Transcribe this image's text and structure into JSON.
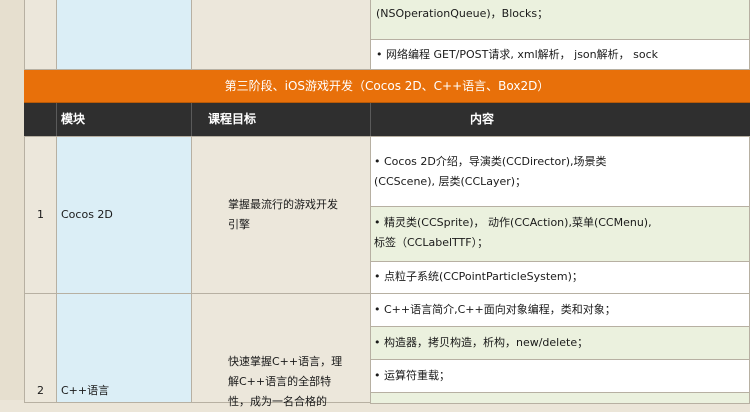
{
  "top_rows": {
    "row_a": "(NSOperationQueue)，Blocks；",
    "row_b": "•  网络编程 GET/POST请求, xml解析， json解析， sock"
  },
  "stage_title": "第三阶段、iOS游戏开发（Cocos 2D、C++语言、Box2D）",
  "headers": {
    "module": "模块",
    "goal": "课程目标",
    "content": "内容"
  },
  "rows": [
    {
      "number": "1",
      "module": "Cocos 2D",
      "goal_line1": "掌握最流行的游戏开发",
      "goal_line2": "引擎",
      "contents": [
        {
          "line1": "•   Cocos 2D介绍，导演类(CCDirector),场景类",
          "line2": "(CCScene), 层类(CCLayer)；"
        },
        {
          "line1": "•   精灵类(CCSprite)， 动作(CCAction),菜单(CCMenu),",
          "line2": "标签（CCLabelTTF）；"
        },
        {
          "line1": "•  点粒子系统(CCPointParticleSystem)；",
          "line2": ""
        }
      ]
    },
    {
      "number": "2",
      "module": "C++语言",
      "goal_line1": "快速掌握C++语言，理",
      "goal_line2": "解C++语言的全部特",
      "goal_line3": "性，成为一名合格的",
      "contents": [
        {
          "line1": "•  C++语言简介,C++面向对象编程，类和对象；"
        },
        {
          "line1": "•  构造器，拷贝构造，析构，new/delete；"
        },
        {
          "line1": "•  运算符重载；"
        },
        {
          "line1": ""
        }
      ]
    }
  ]
}
